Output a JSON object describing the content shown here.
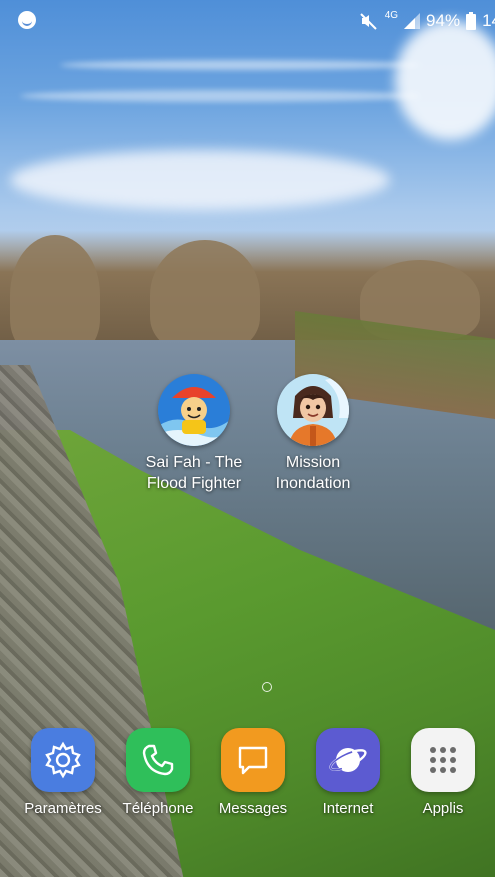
{
  "status_bar": {
    "network": "4G",
    "battery": "94%",
    "clock": "14"
  },
  "home_apps": [
    {
      "name_line1": "Sai Fah - The",
      "name_line2": "Flood Fighter",
      "icon": "sai-fah-app-icon"
    },
    {
      "name_line1": "Mission",
      "name_line2": "Inondation",
      "icon": "mission-inondation-app-icon"
    }
  ],
  "dock": [
    {
      "label": "Paramètres",
      "icon": "gear-icon",
      "color": "#4a7de0"
    },
    {
      "label": "Téléphone",
      "icon": "phone-icon",
      "color": "#2fbf5a"
    },
    {
      "label": "Messages",
      "icon": "message-icon",
      "color": "#f29a1f"
    },
    {
      "label": "Internet",
      "icon": "globe-icon",
      "color": "#5c5bd1"
    },
    {
      "label": "Applis",
      "icon": "grid-icon",
      "color": "#f3f3f3"
    }
  ],
  "page_indicator": {
    "current": 1,
    "total": 1
  }
}
